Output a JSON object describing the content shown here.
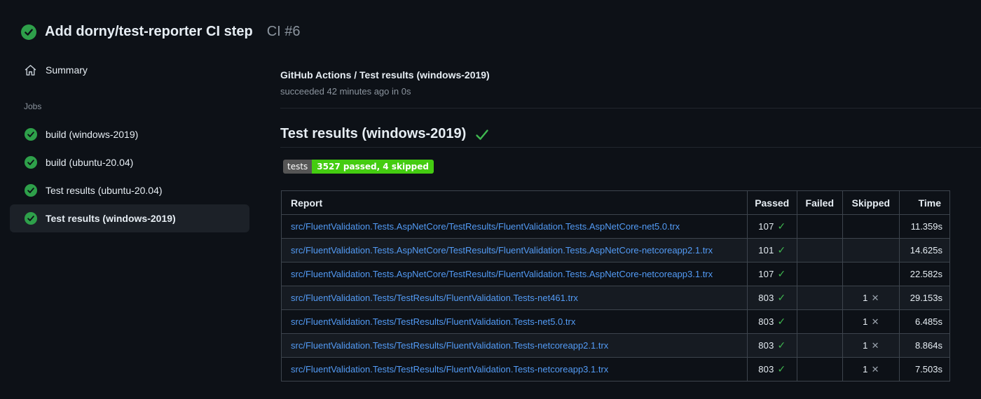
{
  "header": {
    "title": "Add dorny/test-reporter CI step",
    "run_number": "CI #6",
    "status_icon": "check-circle-icon"
  },
  "sidebar": {
    "summary_label": "Summary",
    "jobs_label": "Jobs",
    "jobs": [
      {
        "label": "build (windows-2019)",
        "status": "success",
        "selected": false
      },
      {
        "label": "build (ubuntu-20.04)",
        "status": "success",
        "selected": false
      },
      {
        "label": "Test results (ubuntu-20.04)",
        "status": "success",
        "selected": false
      },
      {
        "label": "Test results (windows-2019)",
        "status": "success",
        "selected": true
      }
    ]
  },
  "main": {
    "run_title": "GitHub Actions / Test results (windows-2019)",
    "run_status": "succeeded 42 minutes ago in 0s",
    "section_title": "Test results (windows-2019)",
    "section_status_icon": "check-icon",
    "badge": {
      "label": "tests",
      "value": "3527 passed, 4 skipped",
      "label_bg": "#555555",
      "value_bg": "#44cc11"
    },
    "table": {
      "columns": [
        "Report",
        "Passed",
        "Failed",
        "Skipped",
        "Time"
      ],
      "rows": [
        {
          "report": "src/FluentValidation.Tests.AspNetCore/TestResults/FluentValidation.Tests.AspNetCore-net5.0.trx",
          "passed": "107",
          "failed": "",
          "skipped": "",
          "time": "11.359s"
        },
        {
          "report": "src/FluentValidation.Tests.AspNetCore/TestResults/FluentValidation.Tests.AspNetCore-netcoreapp2.1.trx",
          "passed": "101",
          "failed": "",
          "skipped": "",
          "time": "14.625s"
        },
        {
          "report": "src/FluentValidation.Tests.AspNetCore/TestResults/FluentValidation.Tests.AspNetCore-netcoreapp3.1.trx",
          "passed": "107",
          "failed": "",
          "skipped": "",
          "time": "22.582s"
        },
        {
          "report": "src/FluentValidation.Tests/TestResults/FluentValidation.Tests-net461.trx",
          "passed": "803",
          "failed": "",
          "skipped": "1",
          "time": "29.153s"
        },
        {
          "report": "src/FluentValidation.Tests/TestResults/FluentValidation.Tests-net5.0.trx",
          "passed": "803",
          "failed": "",
          "skipped": "1",
          "time": "6.485s"
        },
        {
          "report": "src/FluentValidation.Tests/TestResults/FluentValidation.Tests-netcoreapp2.1.trx",
          "passed": "803",
          "failed": "",
          "skipped": "1",
          "time": "8.864s"
        },
        {
          "report": "src/FluentValidation.Tests/TestResults/FluentValidation.Tests-netcoreapp3.1.trx",
          "passed": "803",
          "failed": "",
          "skipped": "1",
          "time": "7.503s"
        }
      ]
    }
  },
  "icons": {
    "pass_glyph": "✓",
    "skip_glyph": "✕"
  },
  "colors": {
    "page_bg": "#0d1117",
    "text": "#e6edf3",
    "muted": "#8b949e",
    "link": "#539bf5",
    "success_circle": "#2ea04a",
    "check_green": "#3fb950",
    "skip_gray": "#9aa3ad",
    "table_border": "#3d444d",
    "selected_item_bg": "#1c2128",
    "badge_label_bg": "#555555",
    "badge_value_bg": "#44cc11"
  }
}
